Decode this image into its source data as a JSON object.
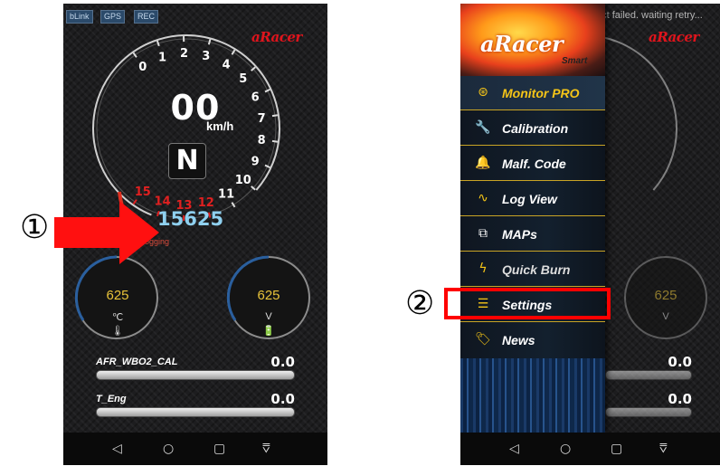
{
  "left_screen": {
    "status_buttons": [
      "bLink",
      "GPS",
      "REC"
    ],
    "logo": "aRacer",
    "speed": "00",
    "speed_unit": "km/h",
    "gear": "N",
    "rpm": "15625",
    "logging_text": "logging",
    "tach_ticks": [
      "0",
      "1",
      "2",
      "3",
      "4",
      "5",
      "6",
      "7",
      "8",
      "9",
      "10",
      "11",
      "12",
      "13",
      "14",
      "15"
    ],
    "gauge_left": {
      "value": "625",
      "unit": "℃",
      "icon": "🌡"
    },
    "gauge_right": {
      "value": "625",
      "unit": "V",
      "icon": "🔋"
    },
    "bars": [
      {
        "label": "AFR_WBO2_CAL",
        "value": "0.0",
        "fill": 1.0
      },
      {
        "label": "T_Eng",
        "value": "0.0",
        "fill": 1.0
      }
    ]
  },
  "right_screen": {
    "status_text": "ect failed. waiting retry...",
    "logo": "aRacer",
    "drawer_logo": "aRacer",
    "drawer_logo_sub": "Smart",
    "menu": [
      {
        "label": "Monitor PRO",
        "icon": "monitor-pro-icon",
        "active": true
      },
      {
        "label": "Calibration",
        "icon": "wrench-icon"
      },
      {
        "label": "Malf. Code",
        "icon": "bell-icon"
      },
      {
        "label": "Log View",
        "icon": "log-view-icon"
      },
      {
        "label": "MAPs",
        "icon": "maps-icon"
      },
      {
        "label": "Quick Burn",
        "icon": "lightning-icon"
      },
      {
        "label": "Settings",
        "icon": "sliders-icon"
      },
      {
        "label": "News",
        "icon": "tag-icon"
      }
    ],
    "bg_values": [
      "0.0",
      "0.0"
    ],
    "bg_gauge_value": "625",
    "bg_gauge_unit": "V"
  },
  "nav_icons": [
    "back-icon",
    "home-icon",
    "recents-icon",
    "menu-down-icon"
  ],
  "annotations": {
    "marker_1": "①",
    "marker_2": "②"
  },
  "colors": {
    "accent_red": "#e0141c",
    "highlight_box": "#ff0000",
    "menu_gold": "#f5c518"
  }
}
